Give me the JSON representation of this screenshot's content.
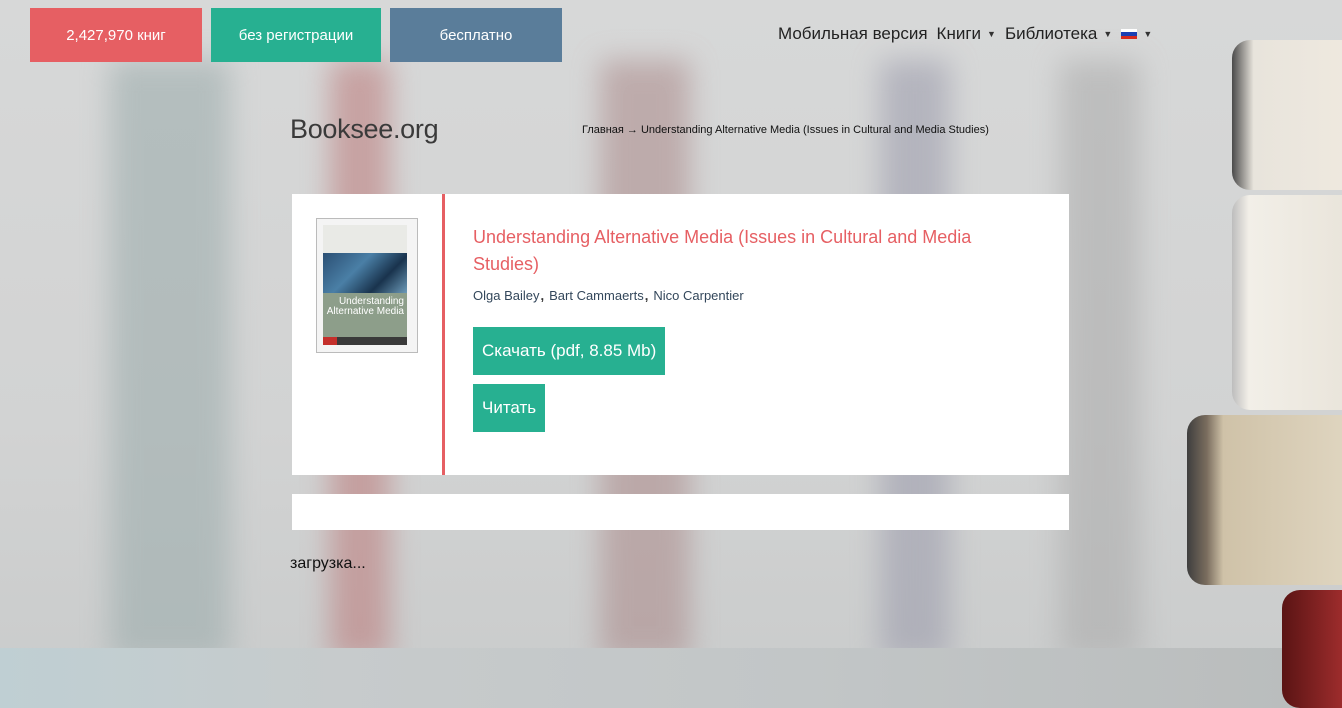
{
  "topbar": {
    "books_count": "2,427,970 книг",
    "no_registration": "без регистрации",
    "free": "бесплатно"
  },
  "nav": {
    "mobile": "Мобильная версия",
    "books": "Книги",
    "library": "Библиотека",
    "language_flag": "russian-flag-icon"
  },
  "header": {
    "logo": "Booksee.org",
    "breadcrumb": "Главная → Understanding Alternative Media (Issues in Cultural and Media Studies)"
  },
  "book": {
    "title": "Understanding Alternative Media (Issues in Cultural and Media Studies)",
    "authors": [
      "Olga Bailey",
      "Bart Cammaerts",
      "Nico Carpentier"
    ],
    "cover_title": "Understanding Alternative Media",
    "download_label": "Скачать (pdf, 8.85 Mb)",
    "read_label": "Читать"
  },
  "status": {
    "loading": "загрузка..."
  },
  "colors": {
    "red": "#e65f63",
    "green": "#27b091",
    "blue": "#5a7d9a"
  }
}
